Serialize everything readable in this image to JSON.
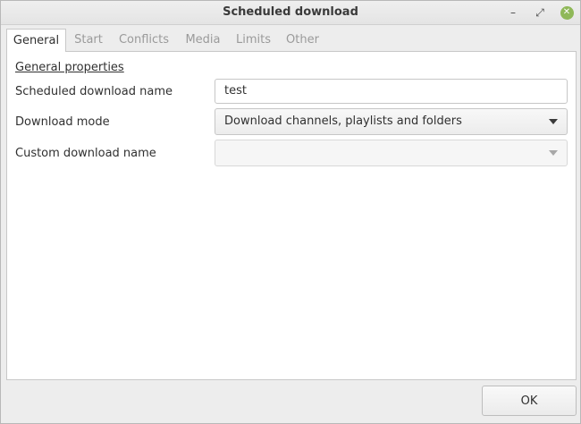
{
  "window": {
    "title": "Scheduled download",
    "minimize_glyph": "–",
    "maximize_glyph": "⤢",
    "close_glyph": "✕"
  },
  "tabs": [
    {
      "label": "General",
      "active": true
    },
    {
      "label": "Start",
      "active": false
    },
    {
      "label": "Conflicts",
      "active": false
    },
    {
      "label": "Media",
      "active": false
    },
    {
      "label": "Limits",
      "active": false
    },
    {
      "label": "Other",
      "active": false
    }
  ],
  "general": {
    "section_title": "General properties",
    "name_label": "Scheduled download name",
    "name_value": "test",
    "mode_label": "Download mode",
    "mode_value": "Download channels, playlists and folders",
    "custom_label": "Custom download name",
    "custom_value": ""
  },
  "footer": {
    "ok_label": "OK"
  },
  "colors": {
    "close_button": "#8fb858",
    "panel_background": "#ffffff",
    "window_background": "#ededed"
  }
}
